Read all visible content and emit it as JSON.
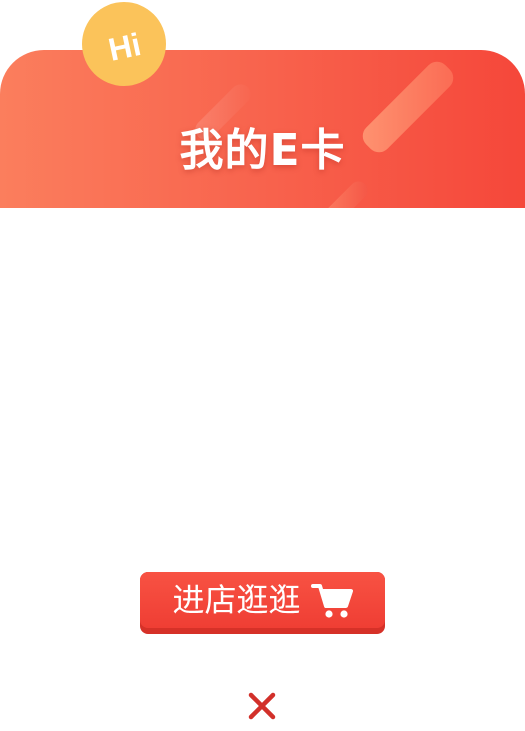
{
  "dialog": {
    "title": "我的E卡",
    "badge_text": "Hi",
    "action_button_label": "进店逛逛",
    "cart_icon": "shopping-cart-icon",
    "close_icon": "close-icon"
  },
  "colors": {
    "banner_start": "#fb7e5d",
    "banner_end": "#f5473a",
    "badge": "#fbc35a",
    "button": "#f04236",
    "close": "#d2302a"
  }
}
